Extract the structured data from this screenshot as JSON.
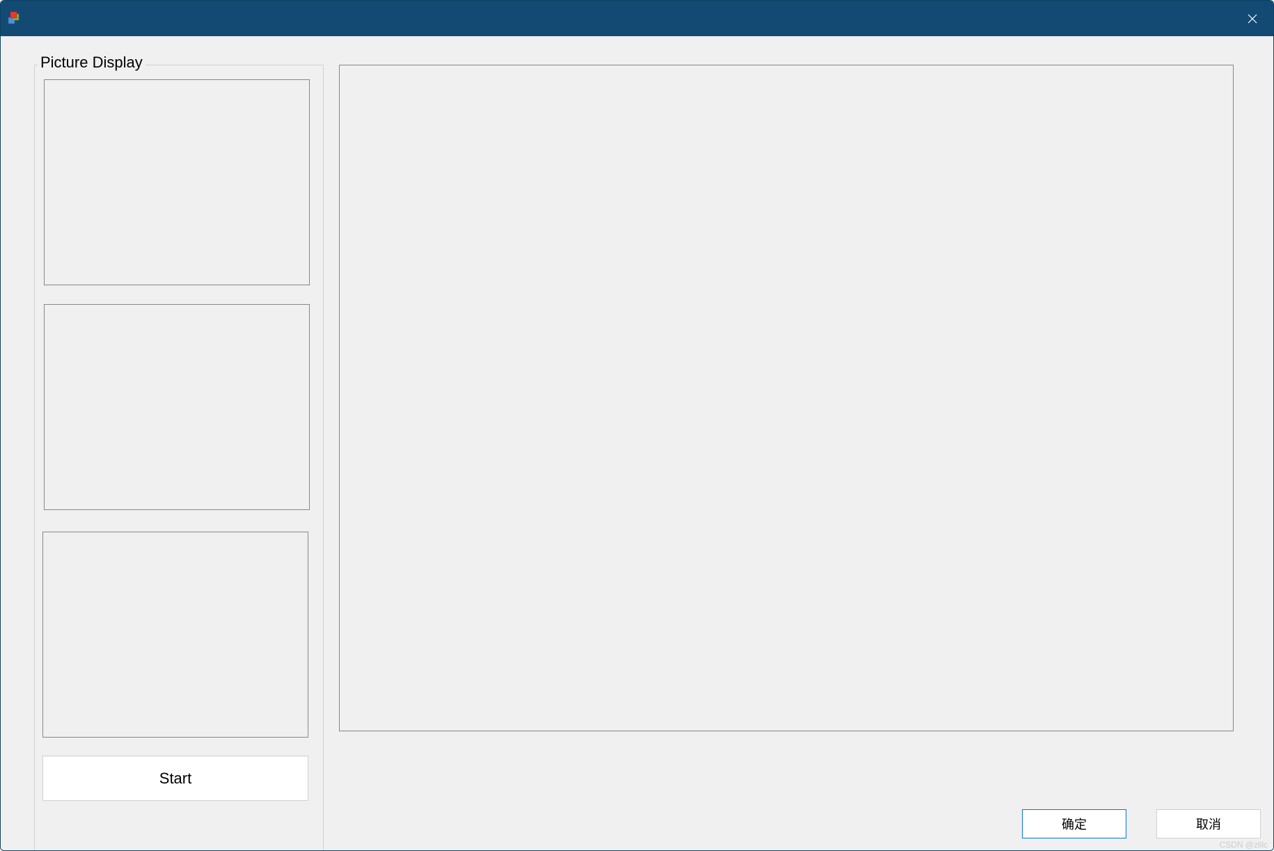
{
  "titlebar": {
    "title": ""
  },
  "groupbox": {
    "label": "Picture Display"
  },
  "buttons": {
    "start": "Start",
    "ok": "确定",
    "cancel": "取消"
  },
  "watermark": "CSDN @zlilc"
}
